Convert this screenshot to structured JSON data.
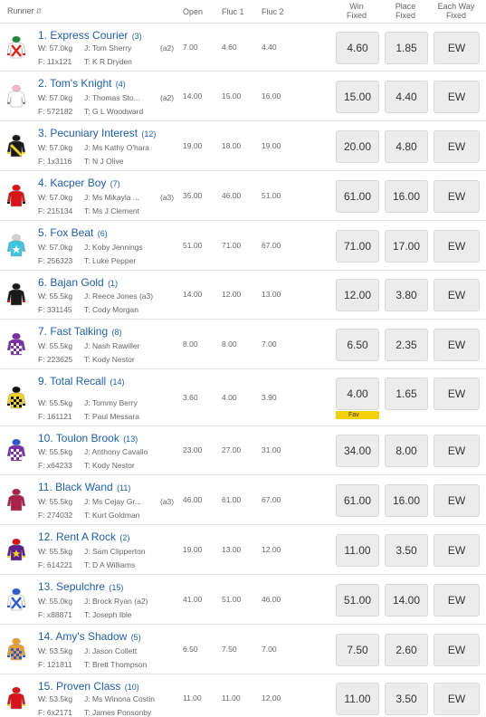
{
  "header": {
    "runner": "Runner",
    "open": "Open",
    "fluc1": "Fluc 1",
    "fluc2": "Fluc 2",
    "win_fixed_1": "Win",
    "win_fixed_2": "Fixed",
    "place_fixed_1": "Place",
    "place_fixed_2": "Fixed",
    "each_way_1": "Each Way",
    "each_way_2": "Fixed"
  },
  "runners": [
    {
      "name": "1. Express Courier",
      "barrier": "(3)",
      "weight": "W: 57.0kg",
      "jockey": "J: Tom Sherry",
      "claim": "(a2)",
      "form": "F: 11x121",
      "trainer": "T: K R Dryden",
      "open": "7.00",
      "fluc1": "4.60",
      "fluc2": "4.40",
      "win": "4.60",
      "place": "1.85",
      "ew": "EW",
      "silk": {
        "body": "#ffffff",
        "accent": "#e0241b",
        "cap": "#1a8a3a",
        "pattern": "cross"
      }
    },
    {
      "name": "2. Tom's Knight",
      "barrier": "(4)",
      "weight": "W: 57.0kg",
      "jockey": "J: Thomas Sto...",
      "claim": "(a2)",
      "form": "F: 572182",
      "trainer": "T: G L Woodward",
      "open": "14.00",
      "fluc1": "15.00",
      "fluc2": "16.00",
      "win": "15.00",
      "place": "4.40",
      "ew": "EW",
      "silk": {
        "body": "#ffffff",
        "accent": "#888888",
        "cap": "#f4b6c8",
        "pattern": "plain"
      }
    },
    {
      "name": "3. Pecuniary Interest",
      "barrier": "(12)",
      "weight": "W: 57.0kg",
      "jockey": "J: Ms Kathy O'hara",
      "claim": "",
      "form": "F: 1x3116",
      "trainer": "T: N J Olive",
      "open": "19.00",
      "fluc1": "18.00",
      "fluc2": "19.00",
      "win": "20.00",
      "place": "4.80",
      "ew": "EW",
      "silk": {
        "body": "#1a1a1a",
        "accent": "#f2d21b",
        "cap": "#1a1a1a",
        "pattern": "sash"
      }
    },
    {
      "name": "4. Kacper Boy",
      "barrier": "(7)",
      "weight": "W: 57.0kg",
      "jockey": "J: Ms Mikayla ...",
      "claim": "(a3)",
      "form": "F: 215134",
      "trainer": "T: Ms J Clement",
      "open": "35.00",
      "fluc1": "46.00",
      "fluc2": "51.00",
      "win": "61.00",
      "place": "16.00",
      "ew": "EW",
      "silk": {
        "body": "#d8141b",
        "accent": "#111111",
        "cap": "#d8141b",
        "pattern": "plain"
      }
    },
    {
      "name": "5. Fox Beat",
      "barrier": "(6)",
      "weight": "W: 57.0kg",
      "jockey": "J: Koby Jennings",
      "claim": "",
      "form": "F: 256323",
      "trainer": "T: Luke Pepper",
      "open": "51.00",
      "fluc1": "71.00",
      "fluc2": "67.00",
      "win": "71.00",
      "place": "17.00",
      "ew": "EW",
      "silk": {
        "body": "#3cc6e0",
        "accent": "#ffffff",
        "cap": "#d0d0d0",
        "pattern": "star"
      }
    },
    {
      "name": "6. Bajan Gold",
      "barrier": "(1)",
      "weight": "W: 55.5kg",
      "jockey": "J: Reece Jones (a3)",
      "claim": "",
      "form": "F: 331145",
      "trainer": "T: Cody Morgan",
      "open": "14.00",
      "fluc1": "12.00",
      "fluc2": "13.00",
      "win": "12.00",
      "place": "3.80",
      "ew": "EW",
      "silk": {
        "body": "#1a1a1a",
        "accent": "#d8141b",
        "cap": "#1a1a1a",
        "pattern": "plain"
      }
    },
    {
      "name": "7. Fast Talking",
      "barrier": "(8)",
      "weight": "W: 55.5kg",
      "jockey": "J: Nash Rawiller",
      "claim": "",
      "form": "F: 223625",
      "trainer": "T: Kody Nestor",
      "open": "8.00",
      "fluc1": "8.00",
      "fluc2": "7.00",
      "win": "6.50",
      "place": "2.35",
      "ew": "EW",
      "silk": {
        "body": "#7a2fa8",
        "accent": "#ffffff",
        "cap": "#7a2fa8",
        "pattern": "check"
      }
    },
    {
      "name": "9. Total Recall",
      "barrier": "(14)",
      "weight": "W: 55.5kg",
      "jockey": "J: Tommy Berry",
      "claim": "",
      "form": "F: 161121",
      "trainer": "T: Paul Messara",
      "open": "3.60",
      "fluc1": "4.00",
      "fluc2": "3.90",
      "win": "4.00",
      "place": "1.65",
      "ew": "EW",
      "fav": "Fav",
      "silk": {
        "body": "#f2d21b",
        "accent": "#111111",
        "cap": "#111111",
        "pattern": "check"
      }
    },
    {
      "name": "10. Toulon Brook",
      "barrier": "(13)",
      "weight": "W: 55.5kg",
      "jockey": "J: Anthony Cavallo",
      "claim": "",
      "form": "F: x64233",
      "trainer": "T: Kody Nestor",
      "open": "23.00",
      "fluc1": "27.00",
      "fluc2": "31.00",
      "win": "34.00",
      "place": "8.00",
      "ew": "EW",
      "silk": {
        "body": "#7a2fa8",
        "accent": "#ffffff",
        "cap": "#2a5bd0",
        "pattern": "check"
      }
    },
    {
      "name": "11. Black Wand",
      "barrier": "(11)",
      "weight": "W: 55.5kg",
      "jockey": "J: Ms Cejay Gr...",
      "claim": "(a3)",
      "form": "F: 274032",
      "trainer": "T: Kurt Goldman",
      "open": "46.00",
      "fluc1": "61.00",
      "fluc2": "67.00",
      "win": "61.00",
      "place": "16.00",
      "ew": "EW",
      "silk": {
        "body": "#a8234b",
        "accent": "#ffffff",
        "cap": "#a8234b",
        "pattern": "plain"
      }
    },
    {
      "name": "12. Rent A Rock",
      "barrier": "(2)",
      "weight": "W: 55.5kg",
      "jockey": "J: Sam Clipperton",
      "claim": "",
      "form": "F: 614221",
      "trainer": "T: D A Williams",
      "open": "19.00",
      "fluc1": "13.00",
      "fluc2": "12.00",
      "win": "11.00",
      "place": "3.50",
      "ew": "EW",
      "silk": {
        "body": "#5a1f8a",
        "accent": "#f2d21b",
        "cap": "#d8141b",
        "pattern": "star"
      }
    },
    {
      "name": "13. Sepulchre",
      "barrier": "(15)",
      "weight": "W: 55.0kg",
      "jockey": "J: Brock Ryan (a2)",
      "claim": "",
      "form": "F: x88871",
      "trainer": "T: Joseph Ible",
      "open": "41.00",
      "fluc1": "51.00",
      "fluc2": "46.00",
      "win": "51.00",
      "place": "14.00",
      "ew": "EW",
      "silk": {
        "body": "#ffffff",
        "accent": "#2a5bd0",
        "cap": "#2a5bd0",
        "pattern": "cross"
      }
    },
    {
      "name": "14. Amy's Shadow",
      "barrier": "(5)",
      "weight": "W: 53.5kg",
      "jockey": "J: Jason Collett",
      "claim": "",
      "form": "F: 121811",
      "trainer": "T: Brett Thompson",
      "open": "6.50",
      "fluc1": "7.50",
      "fluc2": "7.00",
      "win": "7.50",
      "place": "2.60",
      "ew": "EW",
      "silk": {
        "body": "#e8a030",
        "accent": "#2a5bd0",
        "cap": "#e8a030",
        "pattern": "check"
      }
    },
    {
      "name": "15. Proven Class",
      "barrier": "(10)",
      "weight": "W: 53.5kg",
      "jockey": "J: Ms Winona Costin",
      "claim": "",
      "form": "F: 6x2171",
      "trainer": "T: James Ponsonby",
      "open": "11.00",
      "fluc1": "11.00",
      "fluc2": "12.00",
      "win": "11.00",
      "place": "3.50",
      "ew": "EW",
      "silk": {
        "body": "#d8141b",
        "accent": "#f2d21b",
        "cap": "#d8141b",
        "pattern": "plain"
      }
    }
  ]
}
